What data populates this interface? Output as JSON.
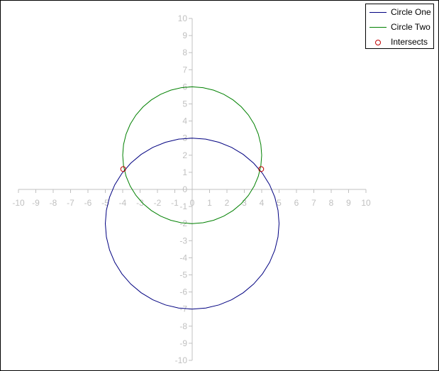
{
  "chart_data": {
    "type": "scatter",
    "title": "",
    "xlabel": "",
    "ylabel": "",
    "xlim": [
      -10,
      10
    ],
    "ylim": [
      -10,
      10
    ],
    "x_ticks": [
      -10,
      -9,
      -8,
      -7,
      -6,
      -5,
      -4,
      -3,
      -2,
      -1,
      0,
      1,
      2,
      3,
      4,
      5,
      6,
      7,
      8,
      9,
      10
    ],
    "y_ticks": [
      10,
      9,
      8,
      7,
      6,
      5,
      4,
      3,
      2,
      1,
      0,
      -1,
      -2,
      -3,
      -4,
      -5,
      -6,
      -7,
      -8,
      -9,
      -10
    ],
    "grid": false,
    "legend_position": "top-right",
    "series": [
      {
        "name": "Circle One",
        "kind": "circle",
        "center": [
          0,
          -2
        ],
        "radius": 5,
        "color": "#000080"
      },
      {
        "name": "Circle Two",
        "kind": "circle",
        "center": [
          0,
          2
        ],
        "radius": 4,
        "color": "#008000"
      },
      {
        "name": "Intersects",
        "kind": "points",
        "points": [
          [
            -3.97,
            1.19
          ],
          [
            3.97,
            1.19
          ]
        ],
        "color": "#c00000"
      }
    ]
  }
}
